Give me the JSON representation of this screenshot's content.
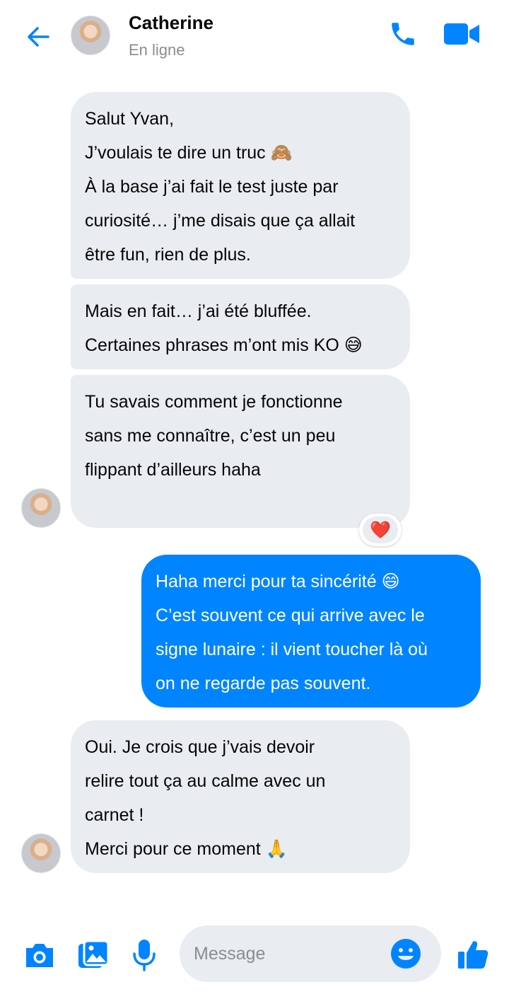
{
  "header": {
    "contact_name": "Catherine",
    "status": "En ligne"
  },
  "messages": [
    {
      "from": "contact",
      "lines": [
        "Salut Yvan,",
        "J’voulais te dire un truc 🙈",
        "À la base j’ai fait le test juste par",
        "curiosité… j’me disais que ça allait",
        "être fun, rien de plus."
      ]
    },
    {
      "from": "contact",
      "lines": [
        "Mais en fait… j’ai été bluffée.",
        "Certaines phrases m’ont mis KO 😅"
      ]
    },
    {
      "from": "contact",
      "lines": [
        "Tu savais comment je fonctionne",
        "sans me connaître, c’est un peu",
        "flippant d’ailleurs haha"
      ],
      "reaction": "❤️"
    },
    {
      "from": "me",
      "lines": [
        "Haha merci pour ta sincérité 😄",
        "C’est souvent ce qui arrive avec le",
        "signe lunaire : il vient toucher là où",
        "on ne regarde pas souvent."
      ]
    },
    {
      "from": "contact",
      "lines": [
        "Oui. Je crois que j’vais devoir",
        "relire tout ça au calme avec un",
        "carnet !",
        "Merci pour ce moment 🙏"
      ]
    }
  ],
  "composer": {
    "placeholder": "Message"
  },
  "icons": {
    "back": "back-arrow-icon",
    "call": "phone-icon",
    "video": "video-camera-icon",
    "camera": "camera-icon",
    "gallery": "image-gallery-icon",
    "mic": "microphone-icon",
    "emoji": "smiley-icon",
    "like": "thumbs-up-icon"
  },
  "colors": {
    "accent": "#0084ff",
    "incoming_bubble": "#e9ecf0",
    "secondary_text": "#8a8d91"
  }
}
